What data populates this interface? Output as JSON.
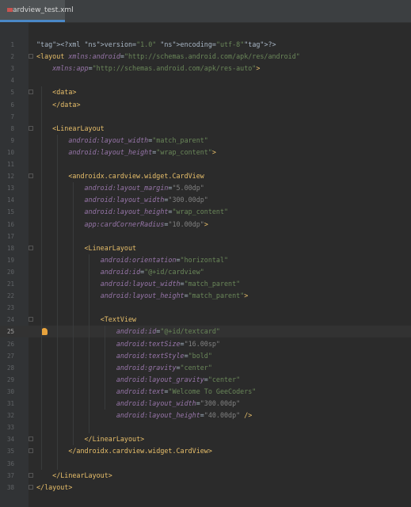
{
  "tab": {
    "filename": "cardview_test.xml",
    "icon": "xml-file-icon"
  },
  "editor": {
    "current_line": 25,
    "lines": [
      {
        "n": "1",
        "text": "<?xml version=\"1.0\" encoding=\"utf-8\"?>"
      },
      {
        "n": "2",
        "text": "<layout xmlns:android=\"http://schemas.android.com/apk/res/android\""
      },
      {
        "n": "3",
        "text": "    xmlns:app=\"http://schemas.android.com/apk/res-auto\">"
      },
      {
        "n": "4",
        "text": ""
      },
      {
        "n": "5",
        "text": "    <data>"
      },
      {
        "n": "6",
        "text": "    </data>"
      },
      {
        "n": "7",
        "text": ""
      },
      {
        "n": "8",
        "text": "    <LinearLayout"
      },
      {
        "n": "9",
        "text": "        android:layout_width=\"match_parent\""
      },
      {
        "n": "10",
        "text": "        android:layout_height=\"wrap_content\">"
      },
      {
        "n": "11",
        "text": ""
      },
      {
        "n": "12",
        "text": "        <androidx.cardview.widget.CardView"
      },
      {
        "n": "13",
        "text": "            android:layout_margin=\"5.00dp\""
      },
      {
        "n": "14",
        "text": "            android:layout_width=\"300.00dp\""
      },
      {
        "n": "15",
        "text": "            android:layout_height=\"wrap_content\""
      },
      {
        "n": "16",
        "text": "            app:cardCornerRadius=\"10.00dp\">"
      },
      {
        "n": "17",
        "text": ""
      },
      {
        "n": "18",
        "text": "            <LinearLayout"
      },
      {
        "n": "19",
        "text": "                android:orientation=\"horizontal\""
      },
      {
        "n": "20",
        "text": "                android:id=\"@+id/cardview\""
      },
      {
        "n": "21",
        "text": "                android:layout_width=\"match_parent\""
      },
      {
        "n": "22",
        "text": "                android:layout_height=\"match_parent\">"
      },
      {
        "n": "23",
        "text": ""
      },
      {
        "n": "24",
        "text": "                <TextView"
      },
      {
        "n": "25",
        "text": "                    android:id=\"@+id/textcard\""
      },
      {
        "n": "26",
        "text": "                    android:textSize=\"16.00sp\""
      },
      {
        "n": "27",
        "text": "                    android:textStyle=\"bold\""
      },
      {
        "n": "28",
        "text": "                    android:gravity=\"center\""
      },
      {
        "n": "29",
        "text": "                    android:layout_gravity=\"center\""
      },
      {
        "n": "30",
        "text": "                    android:text=\"Welcome To GeeCoders\""
      },
      {
        "n": "31",
        "text": "                    android:layout_width=\"300.00dp\""
      },
      {
        "n": "32",
        "text": "                    android:layout_height=\"40.00dp\" />"
      },
      {
        "n": "33",
        "text": ""
      },
      {
        "n": "34",
        "text": "            </LinearLayout>"
      },
      {
        "n": "35",
        "text": "        </androidx.cardview.widget.CardView>"
      },
      {
        "n": "36",
        "text": ""
      },
      {
        "n": "37",
        "text": "    </LinearLayout>"
      },
      {
        "n": "38",
        "text": "</layout>"
      }
    ]
  }
}
